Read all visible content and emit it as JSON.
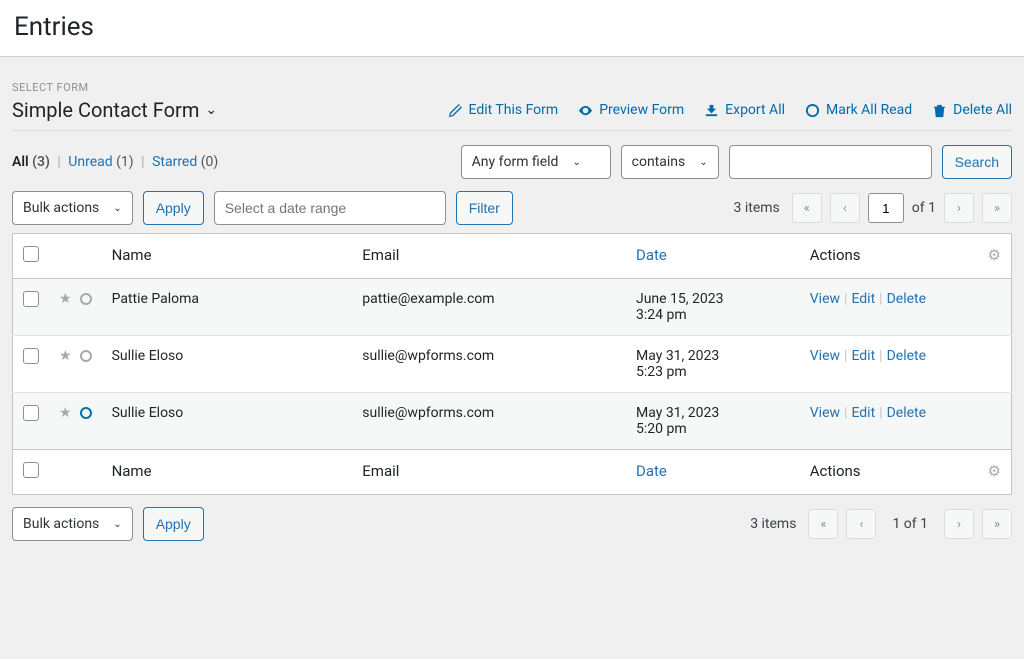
{
  "page_title": "Entries",
  "form_label": "SELECT FORM",
  "form_name": "Simple Contact Form",
  "form_actions": {
    "edit": "Edit This Form",
    "preview": "Preview Form",
    "export": "Export All",
    "mark_read": "Mark All Read",
    "delete_all": "Delete All"
  },
  "views": {
    "all": {
      "label": "All",
      "count": "(3)"
    },
    "unread": {
      "label": "Unread",
      "count": "(1)"
    },
    "starred": {
      "label": "Starred",
      "count": "(0)"
    }
  },
  "search": {
    "field_select": "Any form field",
    "operator_select": "contains",
    "button": "Search"
  },
  "bulk": {
    "label": "Bulk actions",
    "apply": "Apply"
  },
  "date_placeholder": "Select a date range",
  "filter_button": "Filter",
  "pagination": {
    "items_label": "3 items",
    "current": "1",
    "of": "of 1",
    "of_text": "1 of 1"
  },
  "columns": {
    "name": "Name",
    "email": "Email",
    "date": "Date",
    "actions": "Actions"
  },
  "row_actions": {
    "view": "View",
    "edit": "Edit",
    "delete": "Delete"
  },
  "rows": [
    {
      "name": "Pattie Paloma",
      "email": "pattie@example.com",
      "date": "June 15, 2023",
      "time": "3:24 pm",
      "unread": false
    },
    {
      "name": "Sullie Eloso",
      "email": "sullie@wpforms.com",
      "date": "May 31, 2023",
      "time": "5:23 pm",
      "unread": false
    },
    {
      "name": "Sullie Eloso",
      "email": "sullie@wpforms.com",
      "date": "May 31, 2023",
      "time": "5:20 pm",
      "unread": true
    }
  ]
}
